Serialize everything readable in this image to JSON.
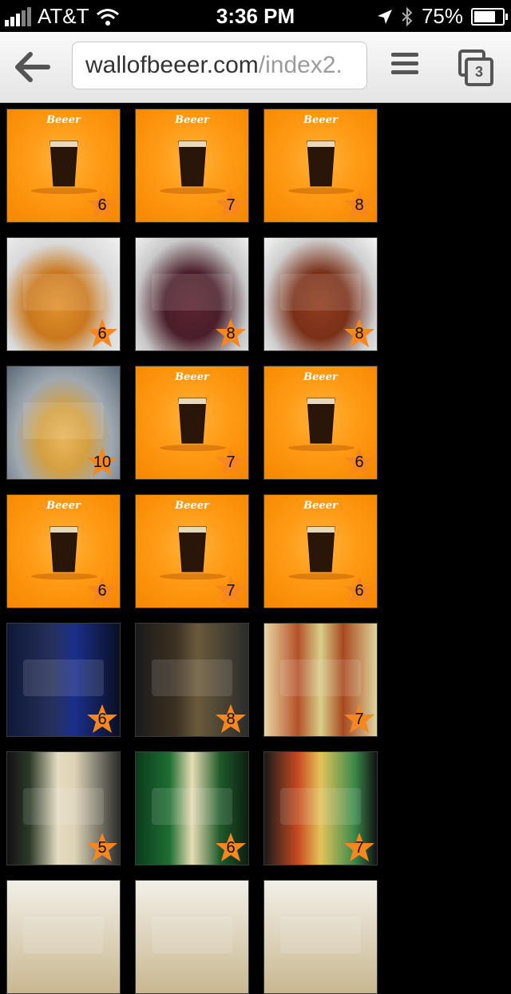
{
  "status_bar": {
    "carrier": "AT&T",
    "time": "3:36 PM",
    "battery": "75%",
    "battery_level": 0.75
  },
  "toolbar": {
    "url_domain": "wallofbeeer.com",
    "url_path": "/index2.",
    "tab_count": "3"
  },
  "placeholder_brand": "Beeer",
  "tiles": [
    {
      "style": "placeholder",
      "rating": "6"
    },
    {
      "style": "placeholder",
      "rating": "7"
    },
    {
      "style": "placeholder",
      "rating": "8"
    },
    {
      "style": "beer-glass",
      "rating": "6"
    },
    {
      "style": "beer-dark",
      "rating": "8"
    },
    {
      "style": "beer-red",
      "rating": "8"
    },
    {
      "style": "beer-pale",
      "rating": "10"
    },
    {
      "style": "placeholder",
      "rating": "7"
    },
    {
      "style": "placeholder",
      "rating": "6"
    },
    {
      "style": "placeholder",
      "rating": "6"
    },
    {
      "style": "placeholder",
      "rating": "7"
    },
    {
      "style": "placeholder",
      "rating": "6"
    },
    {
      "style": "bottle-blue",
      "rating": "6"
    },
    {
      "style": "bottle-belgian",
      "rating": "8"
    },
    {
      "style": "bottle-indian",
      "rating": "7"
    },
    {
      "style": "bottle-strongman",
      "rating": "5"
    },
    {
      "style": "bottle-saddler",
      "rating": "6"
    },
    {
      "style": "bottle-east",
      "rating": "7"
    },
    {
      "style": "bottle-light",
      "rating": ""
    },
    {
      "style": "bottle-light",
      "rating": ""
    },
    {
      "style": "bottle-light",
      "rating": ""
    }
  ],
  "colors": {
    "star": "#f6861f",
    "placeholder_orange": "#ff9a14"
  }
}
